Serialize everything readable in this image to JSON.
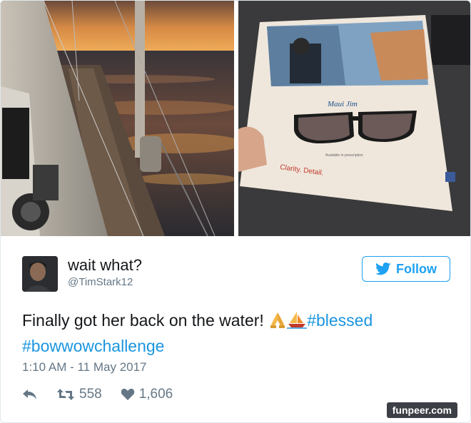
{
  "tweet": {
    "display_name": "wait what?",
    "username": "@TimStark12",
    "follow_label": "Follow",
    "text_part1": "Finally got her back on the water! ",
    "hashtag1": "#blessed",
    "hashtag2": "#bowwowchallenge",
    "timestamp": "1:10 AM - 11 May 2017",
    "retweets": "558",
    "likes": "1,606"
  },
  "ad": {
    "brand": "Maui Jim",
    "caption": "Available in prescription",
    "headline": "Clarity. Detail."
  },
  "watermark": "funpeer.com",
  "icons": {
    "follow": "twitter-bird-icon",
    "reply": "reply-icon",
    "retweet": "retweet-icon",
    "like": "heart-icon",
    "emoji1": "praying-hands-icon",
    "emoji2": "sailboat-icon"
  },
  "colors": {
    "link": "#1b95e0",
    "follow": "#1da1f2",
    "meta": "#657786"
  }
}
